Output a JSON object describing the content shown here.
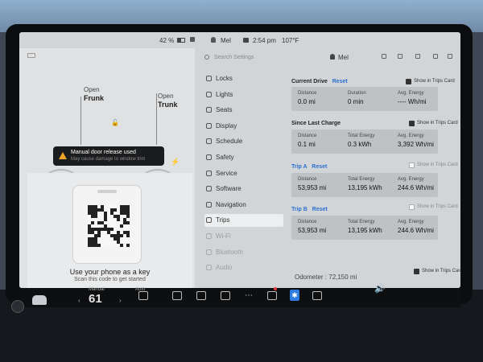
{
  "status_bar": {
    "battery": "42 %",
    "user": "Mel",
    "time": "2:54 pm",
    "temperature": "107°F"
  },
  "car_panel": {
    "frunk": {
      "open": "Open",
      "name": "Frunk"
    },
    "trunk": {
      "open": "Open",
      "name": "Trunk"
    },
    "alert": {
      "title": "Manual door release used",
      "subtitle": "May cause damage to window trim"
    },
    "phone_key": {
      "title": "Use your phone as a key",
      "subtitle": "Scan this code to get started"
    }
  },
  "settings_nav": {
    "search_placeholder": "Search Settings",
    "items": [
      {
        "label": "Locks",
        "icon": "lock-icon"
      },
      {
        "label": "Lights",
        "icon": "lightbulb-icon"
      },
      {
        "label": "Seats",
        "icon": "seat-icon"
      },
      {
        "label": "Display",
        "icon": "display-icon"
      },
      {
        "label": "Schedule",
        "icon": "clock-icon"
      },
      {
        "label": "Safety",
        "icon": "shield-icon"
      },
      {
        "label": "Service",
        "icon": "wrench-icon"
      },
      {
        "label": "Software",
        "icon": "download-icon"
      },
      {
        "label": "Navigation",
        "icon": "navigation-icon"
      },
      {
        "label": "Trips",
        "icon": "trips-icon"
      },
      {
        "label": "Wi-Fi",
        "icon": "wifi-icon"
      },
      {
        "label": "Bluetooth",
        "icon": "bluetooth-icon"
      },
      {
        "label": "Audio",
        "icon": "audio-icon"
      }
    ],
    "active": "Trips"
  },
  "content": {
    "user_name": "Mel",
    "show_in_trips_card": "Show in Trips Card",
    "current_drive": {
      "title": "Current Drive",
      "reset": "Reset",
      "distance_label": "Distance",
      "distance": "0.0 mi",
      "duration_label": "Duration",
      "duration": "0 min",
      "energy_label": "Avg. Energy",
      "energy": "---- Wh/mi"
    },
    "since_last_charge": {
      "title": "Since Last Charge",
      "distance_label": "Distance",
      "distance": "0.1 mi",
      "total_label": "Total Energy",
      "total": "0.3 kWh",
      "energy_label": "Avg. Energy",
      "energy": "3,392 Wh/mi"
    },
    "trip_a": {
      "title": "Trip A",
      "reset": "Reset",
      "distance_label": "Distance",
      "distance": "53,953 mi",
      "total_label": "Total Energy",
      "total": "13,195 kWh",
      "energy_label": "Avg. Energy",
      "energy": "244.6 Wh/mi"
    },
    "trip_b": {
      "title": "Trip B",
      "reset": "Reset",
      "distance_label": "Distance",
      "distance": "53,953 mi",
      "total_label": "Total Energy",
      "total": "13,195 kWh",
      "energy_label": "Avg. Energy",
      "energy": "244.6 Wh/mi"
    },
    "odometer": "Odometer : 72,150 mi"
  },
  "taskbar": {
    "climate_mode": "Manual",
    "cabin_temp": "61",
    "fan_mode": "Auto"
  },
  "colors": {
    "accent": "#2b6fd1",
    "alert": "#f0a427",
    "bluetooth": "#2f7be0"
  }
}
